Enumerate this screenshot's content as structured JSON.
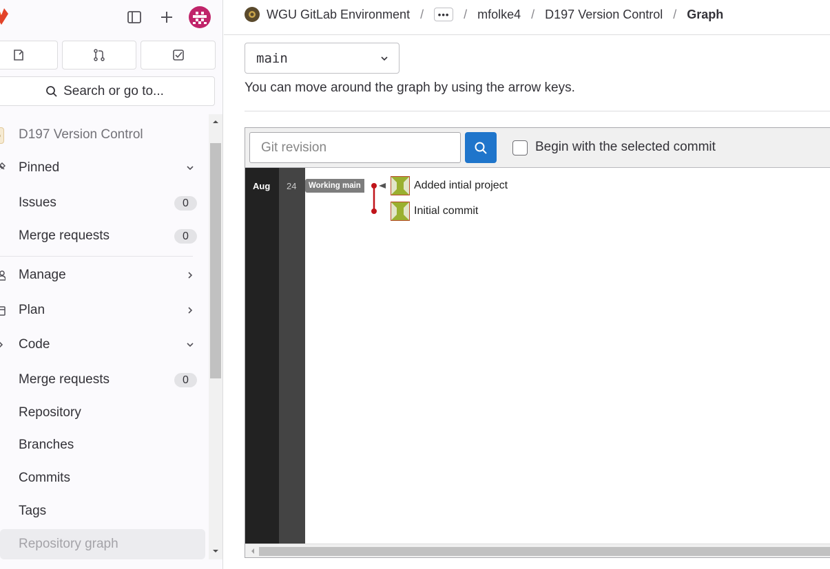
{
  "sidebar": {
    "search_label": "Search or go to...",
    "project_name": "D197 Version Control",
    "project_avatar_letter": "D",
    "pinned_label": "Pinned",
    "pinned_items": [
      {
        "label": "Issues",
        "count": "0"
      },
      {
        "label": "Merge requests",
        "count": "0"
      }
    ],
    "sections": [
      {
        "label": "Manage"
      },
      {
        "label": "Plan"
      },
      {
        "label": "Code"
      }
    ],
    "code_items": [
      {
        "label": "Merge requests",
        "count": "0"
      },
      {
        "label": "Repository"
      },
      {
        "label": "Branches"
      },
      {
        "label": "Commits"
      },
      {
        "label": "Tags"
      },
      {
        "label": "Repository graph"
      }
    ]
  },
  "breadcrumb": {
    "org": "WGU GitLab Environment",
    "ellipsis": "•••",
    "user": "mfolke4",
    "project": "D197 Version Control",
    "current": "Graph"
  },
  "ref_selector": {
    "value": "main"
  },
  "help_text": "You can move around the graph by using the arrow keys.",
  "graph": {
    "revision_placeholder": "Git revision",
    "checkbox_label": "Begin with the selected commit",
    "checkbox_checked": false,
    "month": "Aug",
    "day": "24",
    "branch_tag": "Working main",
    "commits": [
      {
        "message": "Added intial project"
      },
      {
        "message": "Initial commit"
      }
    ]
  },
  "colors": {
    "accent": "#1f75cb",
    "graph_line": "#c0141a",
    "avatar_bg": "#c0246a"
  }
}
